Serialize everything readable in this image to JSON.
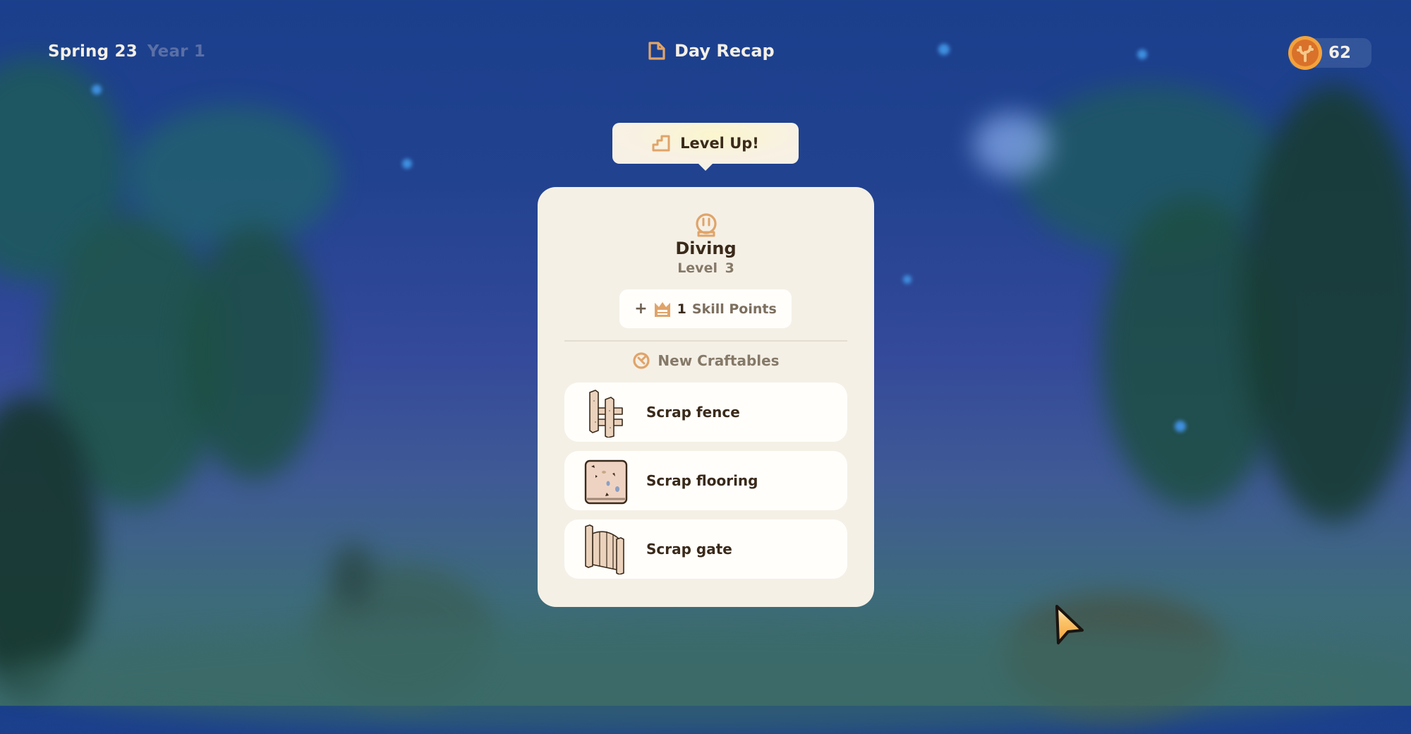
{
  "header": {
    "season_day": "Spring 23",
    "year": "Year 1",
    "title": "Day Recap",
    "title_icon": "document-icon",
    "currency_icon": "coral-coin-icon",
    "currency_value": "62"
  },
  "banner": {
    "icon": "stairs-icon",
    "text": "Level Up!"
  },
  "skill": {
    "icon": "diving-helmet-icon",
    "name": "Diving",
    "level_label": "Level 3",
    "reward": {
      "prefix": "+",
      "icon": "crown-icon",
      "amount": "1",
      "label": "Skill Points"
    }
  },
  "crafts": {
    "heading_icon": "crafting-icon",
    "heading": "New Craftables",
    "items": [
      {
        "name": "Scrap fence",
        "icon": "scrap-fence-icon"
      },
      {
        "name": "Scrap flooring",
        "icon": "scrap-flooring-icon"
      },
      {
        "name": "Scrap gate",
        "icon": "scrap-gate-icon"
      }
    ]
  },
  "colors": {
    "accent": "#e0a469",
    "card_bg": "#f5f0e6",
    "text_dark": "#3a2a1a",
    "text_muted": "#857968",
    "coin_orange": "#f3a23c"
  }
}
